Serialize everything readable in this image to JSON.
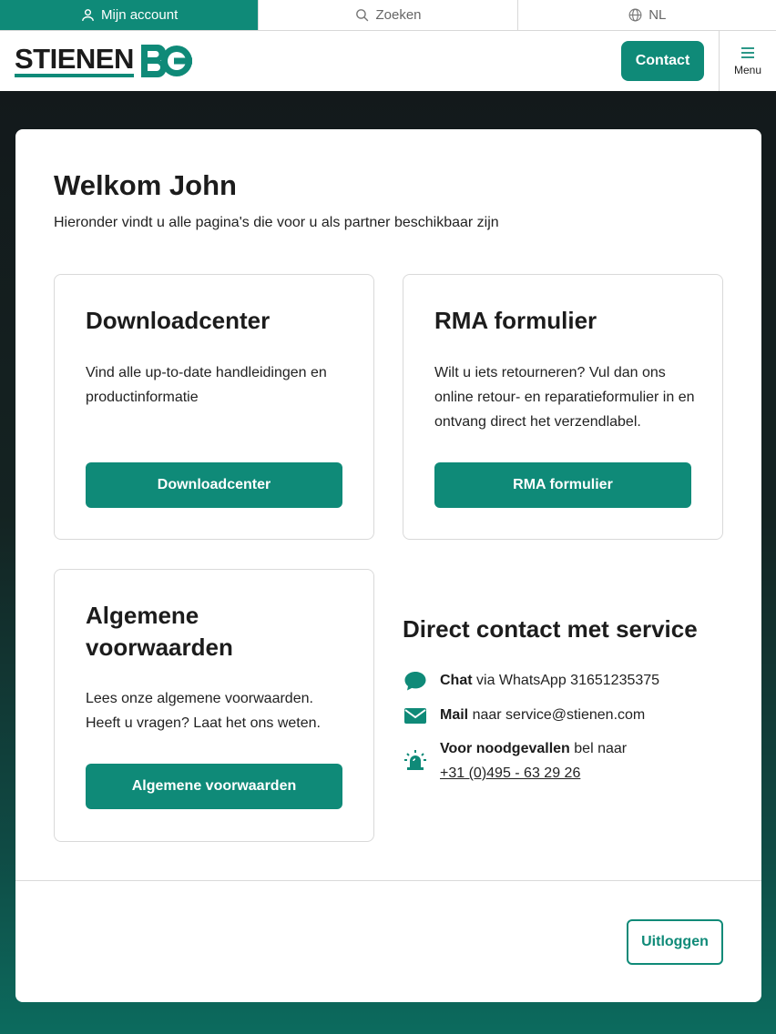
{
  "topbar": {
    "account_label": "Mijn account",
    "search_label": "Zoeken",
    "language_label": "NL"
  },
  "header": {
    "logo_text": "STIENEN",
    "logo_mark": "BE",
    "contact_label": "Contact",
    "menu_label": "Menu"
  },
  "main": {
    "title": "Welkom John",
    "subtitle": "Hieronder vindt u alle pagina's die voor u als partner beschikbaar zijn",
    "tiles": [
      {
        "title": "Downloadcenter",
        "text": "Vind alle up-to-date handleidingen en productinformatie",
        "button": "Downloadcenter"
      },
      {
        "title": "RMA formulier",
        "text": "Wilt u iets retourneren? Vul dan ons online retour- en reparatieformulier in en ontvang direct het verzendlabel.",
        "button": "RMA formulier"
      },
      {
        "title": "Algemene voorwaarden",
        "text": "Lees onze algemene voorwaarden. Heeft u vragen? Laat het ons weten.",
        "button": "Algemene voorwaarden"
      }
    ],
    "service": {
      "title": "Direct contact met service",
      "chat_bold": "Chat",
      "chat_text": "via WhatsApp 31651235375",
      "mail_bold": "Mail",
      "mail_text": "naar service@stienen.com",
      "emergency_bold": "Voor noodgevallen",
      "emergency_text": "bel naar",
      "emergency_phone": "+31 (0)495 - 63 29 26"
    },
    "logout_label": "Uitloggen"
  },
  "colors": {
    "accent": "#0f8a78",
    "text": "#1c1c1c",
    "background_dark": "#13191b"
  },
  "icons": {
    "account": "user-icon",
    "search": "search-icon",
    "language": "globe-icon",
    "menu": "hamburger-icon",
    "chat": "chat-bubble-icon",
    "mail": "envelope-icon",
    "emergency": "siren-icon"
  }
}
